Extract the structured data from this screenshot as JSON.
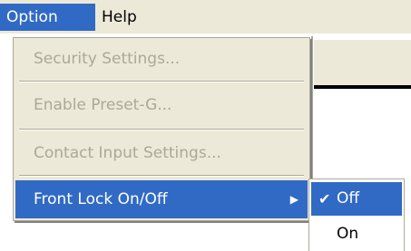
{
  "menubar": {
    "items": [
      {
        "label": "Option"
      },
      {
        "label": "Help"
      }
    ]
  },
  "option_menu": {
    "items": [
      {
        "label": "Security Settings...",
        "enabled": false
      },
      {
        "label": "Enable Preset-G...",
        "enabled": false
      },
      {
        "label": "Contact Input Settings...",
        "enabled": false
      },
      {
        "label": "Front Lock On/Off",
        "enabled": true,
        "has_submenu": true
      }
    ],
    "submenu_arrow_icon": "triangle-right-icon"
  },
  "front_lock_submenu": {
    "items": [
      {
        "label": "Off",
        "checked": true,
        "check_icon": "✔"
      },
      {
        "label": "On",
        "checked": false
      }
    ]
  },
  "colors": {
    "highlight": "#316ac5",
    "menu_bg": "#ece9d8",
    "disabled_text": "#aca899"
  }
}
